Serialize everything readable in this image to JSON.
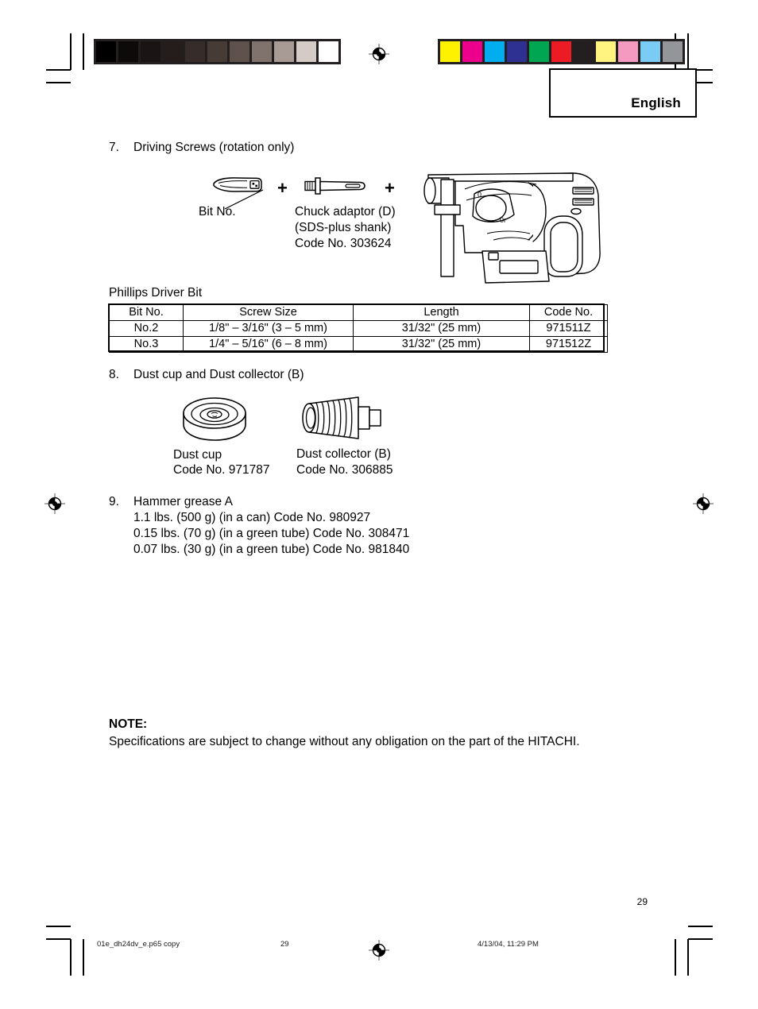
{
  "document": {
    "language_tab": "English",
    "page_number": "29"
  },
  "production_marks": {
    "grayscale_bar": [
      "#000000",
      "#0d0a0a",
      "#1a1514",
      "#241d1b",
      "#362c29",
      "#473b36",
      "#5f524c",
      "#80726c",
      "#a89b95",
      "#d4cac6",
      "#ffffff"
    ],
    "color_bar": [
      "#fff200",
      "#ec008c",
      "#00aeef",
      "#2e3192",
      "#00a651",
      "#ed1c24",
      "#231f20",
      "#fff47f",
      "#f49ac1",
      "#7accf4",
      "#939598"
    ]
  },
  "sections": [
    {
      "number": "7.",
      "title": "Driving Screws (rotation only)",
      "labels": {
        "bit_no": "Bit No.",
        "adaptor_line1": "Chuck adaptor (D)",
        "adaptor_line2": "(SDS-plus shank)",
        "adaptor_line3": "Code No. 303624",
        "plus1": "+",
        "plus2": "+"
      },
      "subtitle": "Phillips Driver Bit",
      "table": {
        "headers": [
          "Bit No.",
          "Screw Size",
          "Length",
          "Code No."
        ],
        "rows": [
          [
            "No.2",
            "1/8\" – 3/16\" (3 – 5 mm)",
            "31/32\" (25 mm)",
            "971511Z"
          ],
          [
            "No.3",
            "1/4\" – 5/16\" (6 – 8 mm)",
            "31/32\" (25 mm)",
            "971512Z"
          ]
        ]
      }
    },
    {
      "number": "8.",
      "title": "Dust cup and Dust collector (B)",
      "items": [
        {
          "name": "Dust cup",
          "code": "Code No. 971787"
        },
        {
          "name": "Dust collector (B)",
          "code": "Code No. 306885"
        }
      ]
    },
    {
      "number": "9.",
      "title": "Hammer grease A",
      "lines": [
        "1.1 lbs. (500 g) (in a can) Code No. 980927",
        "0.15 lbs. (70 g) (in a green tube) Code No. 308471",
        "0.07 lbs. (30 g) (in a green tube) Code No. 981840"
      ]
    }
  ],
  "note": {
    "label": "NOTE:",
    "body": "Specifications are subject to change without any obligation on the part of the HITACHI."
  },
  "footer": {
    "filename": "01e_dh24dv_e.p65 copy",
    "page": "29",
    "timestamp": "4/13/04, 11:29 PM"
  }
}
